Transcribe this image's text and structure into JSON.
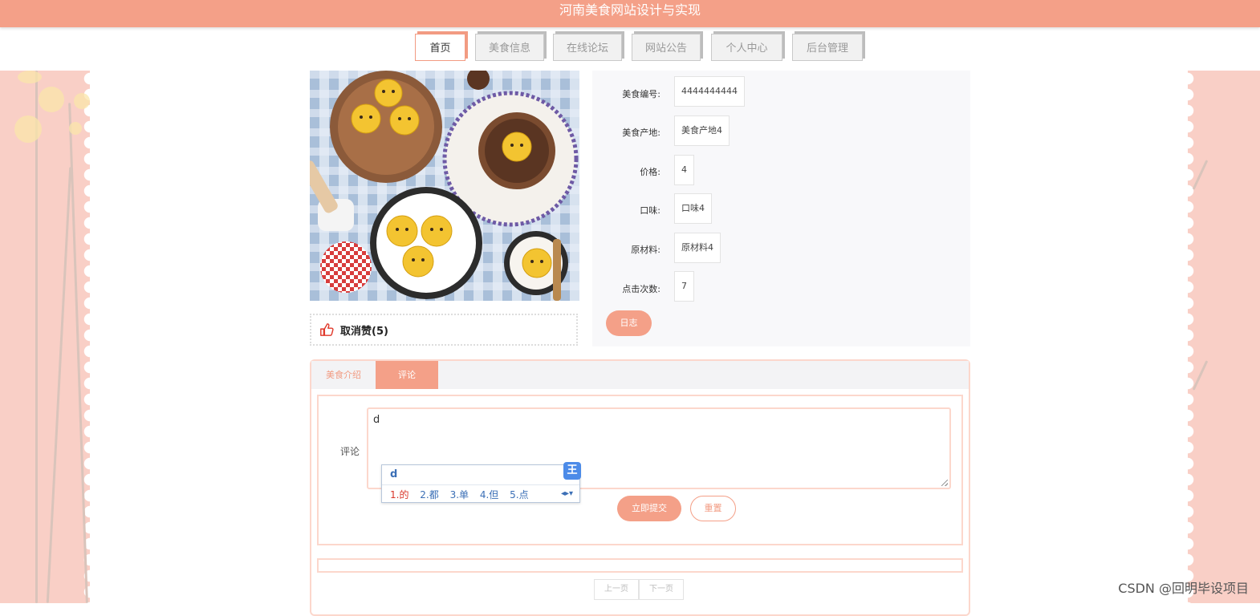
{
  "header": {
    "title": "河南美食网站设计与实现"
  },
  "nav": {
    "tabs": [
      {
        "label": "首页",
        "active": true
      },
      {
        "label": "美食信息",
        "active": false
      },
      {
        "label": "在线论坛",
        "active": false
      },
      {
        "label": "网站公告",
        "active": false
      },
      {
        "label": "个人中心",
        "active": false
      },
      {
        "label": "后台管理",
        "active": false
      }
    ]
  },
  "like": {
    "label": "取消赞(5)"
  },
  "detail": {
    "fields": [
      {
        "label": "美食编号:",
        "value": "4444444444"
      },
      {
        "label": "美食产地:",
        "value": "美食产地4"
      },
      {
        "label": "价格:",
        "value": "4"
      },
      {
        "label": "口味:",
        "value": "口味4"
      },
      {
        "label": "原材料:",
        "value": "原材料4"
      },
      {
        "label": "点击次数:",
        "value": "7"
      }
    ],
    "log_button": "日志"
  },
  "tabs": {
    "intro": "美食介绍",
    "comment": "评论"
  },
  "comment_form": {
    "label": "评论",
    "value": "d",
    "submit": "立即提交",
    "reset": "重置"
  },
  "ime": {
    "input": "d",
    "logo": "王",
    "candidates": [
      "1.的",
      "2.都",
      "3.单",
      "4.但",
      "5.点"
    ],
    "arrows": "◂▸▾"
  },
  "pager": {
    "prev": "上一页",
    "next": "下一页"
  },
  "watermark": "CSDN @回明毕设项目",
  "colors": {
    "accent": "#f4a088",
    "side": "#f9cfc6"
  }
}
